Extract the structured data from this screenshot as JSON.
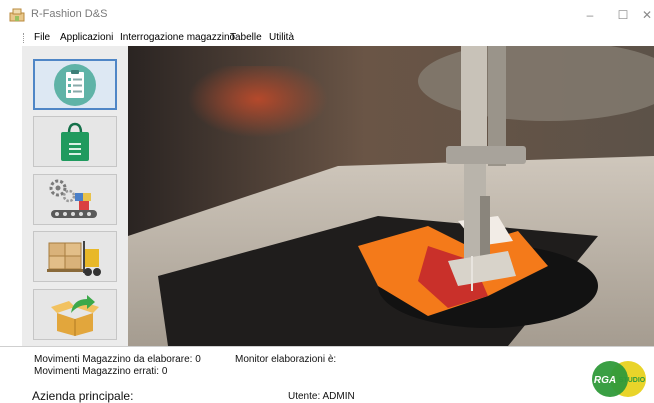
{
  "window": {
    "title": "R-Fashion D&S",
    "minimize_glyph": "–",
    "maximize_glyph": "☐",
    "close_glyph": "✕"
  },
  "menu": {
    "items": [
      "File",
      "Applicazioni",
      "Interrogazione magazzino",
      "Tabelle",
      "Utilità"
    ]
  },
  "sidebar": {
    "tiles": [
      {
        "icon": "checklist-icon",
        "active": true
      },
      {
        "icon": "shopping-bag-icon",
        "active": false
      },
      {
        "icon": "conveyor-gears-icon",
        "active": false
      },
      {
        "icon": "forklift-icon",
        "active": false
      },
      {
        "icon": "open-box-arrow-icon",
        "active": false
      }
    ]
  },
  "hero": {
    "icon": "sewing-machine-image"
  },
  "status": {
    "movimenti_da_elaborare": "Movimenti Magazzino da elaborare: 0",
    "movimenti_errati": "Movimenti Magazzino errati: 0",
    "monitor": "Monitor elaborazioni è:",
    "azienda": "Azienda principale:",
    "utente": "Utente: ADMIN"
  },
  "logo": {
    "left_text": "RGA",
    "right_text": "STUDIO",
    "colors": {
      "green": "#2f9a3a",
      "yellow": "#e9d42a"
    }
  },
  "colors": {
    "tile_active_border": "#4f86c6",
    "bag_green": "#1f9a5e",
    "checklist_teal": "#5fb3a7"
  }
}
